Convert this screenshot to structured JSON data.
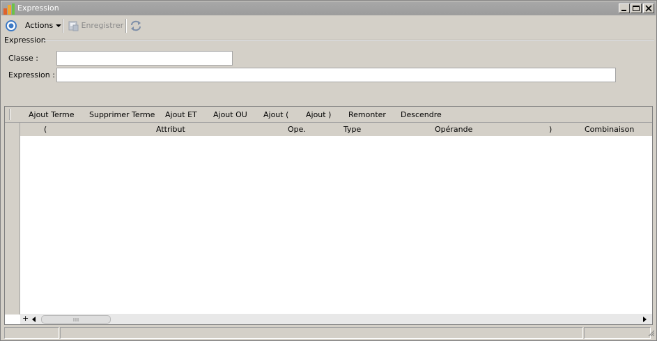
{
  "window": {
    "title": "Expression"
  },
  "toolbar": {
    "actions_label": "Actions",
    "save_label": "Enregistrer"
  },
  "group": {
    "label": "Expression"
  },
  "form": {
    "classe_label": "Classe :",
    "classe_value": "",
    "expression_label": "Expression :",
    "expression_value": ""
  },
  "grid_toolbar": {
    "buttons": [
      "Ajout Terme",
      "Supprimer Terme",
      "Ajout ET",
      "Ajout OU",
      "Ajout (",
      "Ajout )",
      "Remonter",
      "Descendre"
    ]
  },
  "grid": {
    "columns": [
      "(",
      "Attribut",
      "Ope.",
      "Type",
      "Opérande",
      ")",
      "Combinaison"
    ],
    "rows": []
  },
  "scrollbar": {
    "add_symbol": "+"
  },
  "colors": {
    "titlebar": "#9c9c9c",
    "window_bg": "#d4d0c8",
    "accent_icon": "#3b78c4"
  }
}
